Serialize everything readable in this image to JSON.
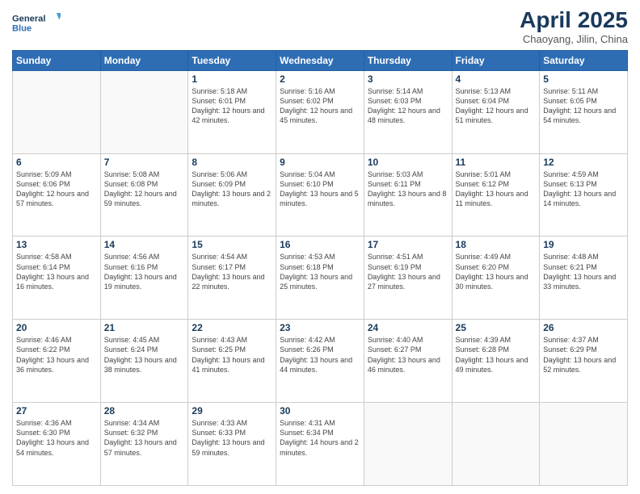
{
  "header": {
    "logo_line1": "General",
    "logo_line2": "Blue",
    "title": "April 2025",
    "subtitle": "Chaoyang, Jilin, China"
  },
  "weekdays": [
    "Sunday",
    "Monday",
    "Tuesday",
    "Wednesday",
    "Thursday",
    "Friday",
    "Saturday"
  ],
  "weeks": [
    [
      {
        "day": "",
        "info": ""
      },
      {
        "day": "",
        "info": ""
      },
      {
        "day": "1",
        "info": "Sunrise: 5:18 AM\nSunset: 6:01 PM\nDaylight: 12 hours\nand 42 minutes."
      },
      {
        "day": "2",
        "info": "Sunrise: 5:16 AM\nSunset: 6:02 PM\nDaylight: 12 hours\nand 45 minutes."
      },
      {
        "day": "3",
        "info": "Sunrise: 5:14 AM\nSunset: 6:03 PM\nDaylight: 12 hours\nand 48 minutes."
      },
      {
        "day": "4",
        "info": "Sunrise: 5:13 AM\nSunset: 6:04 PM\nDaylight: 12 hours\nand 51 minutes."
      },
      {
        "day": "5",
        "info": "Sunrise: 5:11 AM\nSunset: 6:05 PM\nDaylight: 12 hours\nand 54 minutes."
      }
    ],
    [
      {
        "day": "6",
        "info": "Sunrise: 5:09 AM\nSunset: 6:06 PM\nDaylight: 12 hours\nand 57 minutes."
      },
      {
        "day": "7",
        "info": "Sunrise: 5:08 AM\nSunset: 6:08 PM\nDaylight: 12 hours\nand 59 minutes."
      },
      {
        "day": "8",
        "info": "Sunrise: 5:06 AM\nSunset: 6:09 PM\nDaylight: 13 hours\nand 2 minutes."
      },
      {
        "day": "9",
        "info": "Sunrise: 5:04 AM\nSunset: 6:10 PM\nDaylight: 13 hours\nand 5 minutes."
      },
      {
        "day": "10",
        "info": "Sunrise: 5:03 AM\nSunset: 6:11 PM\nDaylight: 13 hours\nand 8 minutes."
      },
      {
        "day": "11",
        "info": "Sunrise: 5:01 AM\nSunset: 6:12 PM\nDaylight: 13 hours\nand 11 minutes."
      },
      {
        "day": "12",
        "info": "Sunrise: 4:59 AM\nSunset: 6:13 PM\nDaylight: 13 hours\nand 14 minutes."
      }
    ],
    [
      {
        "day": "13",
        "info": "Sunrise: 4:58 AM\nSunset: 6:14 PM\nDaylight: 13 hours\nand 16 minutes."
      },
      {
        "day": "14",
        "info": "Sunrise: 4:56 AM\nSunset: 6:16 PM\nDaylight: 13 hours\nand 19 minutes."
      },
      {
        "day": "15",
        "info": "Sunrise: 4:54 AM\nSunset: 6:17 PM\nDaylight: 13 hours\nand 22 minutes."
      },
      {
        "day": "16",
        "info": "Sunrise: 4:53 AM\nSunset: 6:18 PM\nDaylight: 13 hours\nand 25 minutes."
      },
      {
        "day": "17",
        "info": "Sunrise: 4:51 AM\nSunset: 6:19 PM\nDaylight: 13 hours\nand 27 minutes."
      },
      {
        "day": "18",
        "info": "Sunrise: 4:49 AM\nSunset: 6:20 PM\nDaylight: 13 hours\nand 30 minutes."
      },
      {
        "day": "19",
        "info": "Sunrise: 4:48 AM\nSunset: 6:21 PM\nDaylight: 13 hours\nand 33 minutes."
      }
    ],
    [
      {
        "day": "20",
        "info": "Sunrise: 4:46 AM\nSunset: 6:22 PM\nDaylight: 13 hours\nand 36 minutes."
      },
      {
        "day": "21",
        "info": "Sunrise: 4:45 AM\nSunset: 6:24 PM\nDaylight: 13 hours\nand 38 minutes."
      },
      {
        "day": "22",
        "info": "Sunrise: 4:43 AM\nSunset: 6:25 PM\nDaylight: 13 hours\nand 41 minutes."
      },
      {
        "day": "23",
        "info": "Sunrise: 4:42 AM\nSunset: 6:26 PM\nDaylight: 13 hours\nand 44 minutes."
      },
      {
        "day": "24",
        "info": "Sunrise: 4:40 AM\nSunset: 6:27 PM\nDaylight: 13 hours\nand 46 minutes."
      },
      {
        "day": "25",
        "info": "Sunrise: 4:39 AM\nSunset: 6:28 PM\nDaylight: 13 hours\nand 49 minutes."
      },
      {
        "day": "26",
        "info": "Sunrise: 4:37 AM\nSunset: 6:29 PM\nDaylight: 13 hours\nand 52 minutes."
      }
    ],
    [
      {
        "day": "27",
        "info": "Sunrise: 4:36 AM\nSunset: 6:30 PM\nDaylight: 13 hours\nand 54 minutes."
      },
      {
        "day": "28",
        "info": "Sunrise: 4:34 AM\nSunset: 6:32 PM\nDaylight: 13 hours\nand 57 minutes."
      },
      {
        "day": "29",
        "info": "Sunrise: 4:33 AM\nSunset: 6:33 PM\nDaylight: 13 hours\nand 59 minutes."
      },
      {
        "day": "30",
        "info": "Sunrise: 4:31 AM\nSunset: 6:34 PM\nDaylight: 14 hours\nand 2 minutes."
      },
      {
        "day": "",
        "info": ""
      },
      {
        "day": "",
        "info": ""
      },
      {
        "day": "",
        "info": ""
      }
    ]
  ]
}
